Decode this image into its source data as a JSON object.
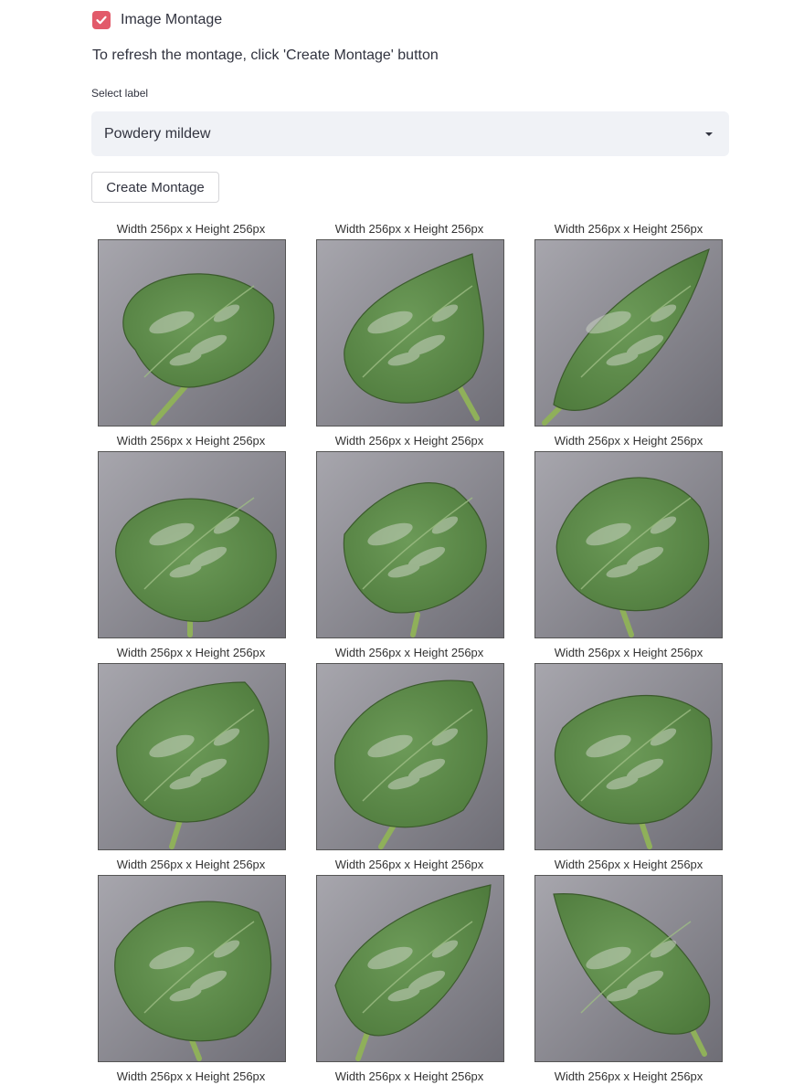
{
  "checkbox": {
    "label": "Image Montage",
    "checked": true,
    "icon": "check-icon",
    "color": "#e25a6a"
  },
  "info_text": "To refresh the montage, click 'Create Montage' button",
  "select": {
    "label": "Select label",
    "value": "Powdery mildew",
    "icon": "caret-down-icon",
    "background": "#f0f2f6"
  },
  "button": {
    "label": "Create Montage"
  },
  "montage": {
    "caption": "Width 256px x Height 256px",
    "rows": 4,
    "cols": 3,
    "images": [
      {
        "subject": "powdery mildew leaf"
      },
      {
        "subject": "powdery mildew leaf"
      },
      {
        "subject": "powdery mildew leaf"
      },
      {
        "subject": "powdery mildew leaf"
      },
      {
        "subject": "powdery mildew leaf"
      },
      {
        "subject": "powdery mildew leaf"
      },
      {
        "subject": "powdery mildew leaf"
      },
      {
        "subject": "powdery mildew leaf"
      },
      {
        "subject": "powdery mildew leaf"
      },
      {
        "subject": "powdery mildew leaf"
      },
      {
        "subject": "powdery mildew leaf"
      },
      {
        "subject": "powdery mildew leaf"
      }
    ],
    "colors": {
      "background": "#8f8e96",
      "leaf": "#4e7a3c",
      "mildew": "#c9d2c2"
    }
  }
}
